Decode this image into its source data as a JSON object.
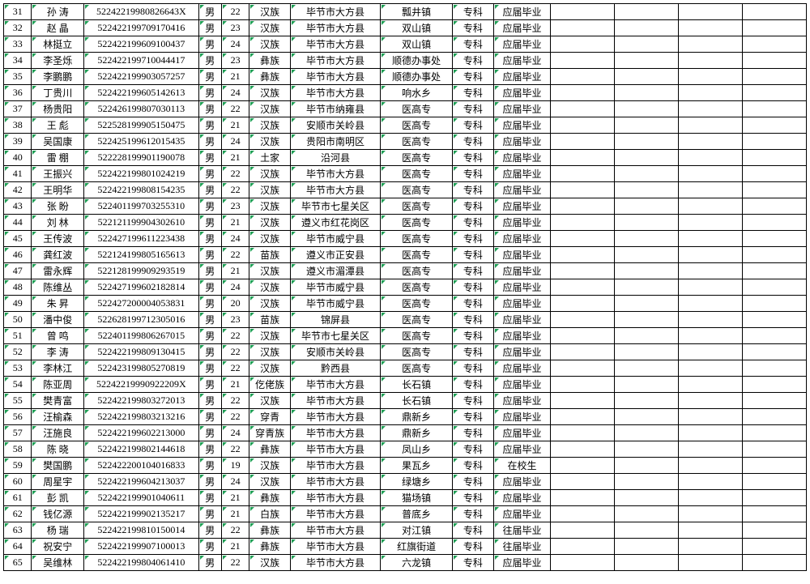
{
  "rows": [
    {
      "n": "31",
      "name": "孙  涛",
      "id": "52242219980826643X",
      "sex": "男",
      "age": "22",
      "eth": "汉族",
      "place": "毕节市大方县",
      "town": "瓢井镇",
      "edu": "专科",
      "stat": "应届毕业"
    },
    {
      "n": "32",
      "name": "赵  晶",
      "id": "522422199709170416",
      "sex": "男",
      "age": "23",
      "eth": "汉族",
      "place": "毕节市大方县",
      "town": "双山镇",
      "edu": "专科",
      "stat": "应届毕业"
    },
    {
      "n": "33",
      "name": "林挺立",
      "id": "522422199609100437",
      "sex": "男",
      "age": "24",
      "eth": "汉族",
      "place": "毕节市大方县",
      "town": "双山镇",
      "edu": "专科",
      "stat": "应届毕业"
    },
    {
      "n": "34",
      "name": "李圣烁",
      "id": "522422199710044417",
      "sex": "男",
      "age": "23",
      "eth": "彝族",
      "place": "毕节市大方县",
      "town": "顺德办事处",
      "edu": "专科",
      "stat": "应届毕业"
    },
    {
      "n": "35",
      "name": "李鹏鹏",
      "id": "522422199903057257",
      "sex": "男",
      "age": "21",
      "eth": "彝族",
      "place": "毕节市大方县",
      "town": "顺德办事处",
      "edu": "专科",
      "stat": "应届毕业"
    },
    {
      "n": "36",
      "name": "丁贵川",
      "id": "522422199605142613",
      "sex": "男",
      "age": "24",
      "eth": "汉族",
      "place": "毕节市大方县",
      "town": "响水乡",
      "edu": "专科",
      "stat": "应届毕业"
    },
    {
      "n": "37",
      "name": "杨贵阳",
      "id": "522426199807030113",
      "sex": "男",
      "age": "22",
      "eth": "汉族",
      "place": "毕节市纳雍县",
      "town": "医高专",
      "edu": "专科",
      "stat": "应届毕业"
    },
    {
      "n": "38",
      "name": "王  彪",
      "id": "522528199905150475",
      "sex": "男",
      "age": "21",
      "eth": "汉族",
      "place": "安顺市关岭县",
      "town": "医高专",
      "edu": "专科",
      "stat": "应届毕业"
    },
    {
      "n": "39",
      "name": "吴国康",
      "id": "522425199612015435",
      "sex": "男",
      "age": "24",
      "eth": "汉族",
      "place": "贵阳市南明区",
      "town": "医高专",
      "edu": "专科",
      "stat": "应届毕业"
    },
    {
      "n": "40",
      "name": "雷  棚",
      "id": "522228199901190078",
      "sex": "男",
      "age": "21",
      "eth": "土家",
      "place": "沿河县",
      "town": "医高专",
      "edu": "专科",
      "stat": "应届毕业"
    },
    {
      "n": "41",
      "name": "王振兴",
      "id": "522422199801024219",
      "sex": "男",
      "age": "22",
      "eth": "汉族",
      "place": "毕节市大方县",
      "town": "医高专",
      "edu": "专科",
      "stat": "应届毕业"
    },
    {
      "n": "42",
      "name": "王明华",
      "id": "522422199808154235",
      "sex": "男",
      "age": "22",
      "eth": "汉族",
      "place": "毕节市大方县",
      "town": "医高专",
      "edu": "专科",
      "stat": "应届毕业"
    },
    {
      "n": "43",
      "name": "张  盼",
      "id": "522401199703255310",
      "sex": "男",
      "age": "23",
      "eth": "汉族",
      "place": "毕节市七星关区",
      "town": "医高专",
      "edu": "专科",
      "stat": "应届毕业"
    },
    {
      "n": "44",
      "name": "刘  林",
      "id": "522121199904302610",
      "sex": "男",
      "age": "21",
      "eth": "汉族",
      "place": "遵义市红花岗区",
      "town": "医高专",
      "edu": "专科",
      "stat": "应届毕业"
    },
    {
      "n": "45",
      "name": "王传波",
      "id": "522427199611223438",
      "sex": "男",
      "age": "24",
      "eth": "汉族",
      "place": "毕节市威宁县",
      "town": "医高专",
      "edu": "专科",
      "stat": "应届毕业"
    },
    {
      "n": "46",
      "name": "龚红波",
      "id": "522124199805165613",
      "sex": "男",
      "age": "22",
      "eth": "苗族",
      "place": "遵义市正安县",
      "town": "医高专",
      "edu": "专科",
      "stat": "应届毕业"
    },
    {
      "n": "47",
      "name": "雷永辉",
      "id": "522128199909293519",
      "sex": "男",
      "age": "21",
      "eth": "汉族",
      "place": "遵义市湄潭县",
      "town": "医高专",
      "edu": "专科",
      "stat": "应届毕业"
    },
    {
      "n": "48",
      "name": "陈维丛",
      "id": "522427199602182814",
      "sex": "男",
      "age": "24",
      "eth": "汉族",
      "place": "毕节市威宁县",
      "town": "医高专",
      "edu": "专科",
      "stat": "应届毕业"
    },
    {
      "n": "49",
      "name": "朱  昇",
      "id": "522427200004053831",
      "sex": "男",
      "age": "20",
      "eth": "汉族",
      "place": "毕节市威宁县",
      "town": "医高专",
      "edu": "专科",
      "stat": "应届毕业"
    },
    {
      "n": "50",
      "name": "潘中俊",
      "id": "522628199712305016",
      "sex": "男",
      "age": "23",
      "eth": "苗族",
      "place": "锦屏县",
      "town": "医高专",
      "edu": "专科",
      "stat": "应届毕业"
    },
    {
      "n": "51",
      "name": "曾  鸣",
      "id": "522401199806267015",
      "sex": "男",
      "age": "22",
      "eth": "汉族",
      "place": "毕节市七星关区",
      "town": "医高专",
      "edu": "专科",
      "stat": "应届毕业"
    },
    {
      "n": "52",
      "name": "李  涛",
      "id": "522422199809130415",
      "sex": "男",
      "age": "22",
      "eth": "汉族",
      "place": "安顺市关岭县",
      "town": "医高专",
      "edu": "专科",
      "stat": "应届毕业"
    },
    {
      "n": "53",
      "name": "李林江",
      "id": "522423199805270819",
      "sex": "男",
      "age": "22",
      "eth": "汉族",
      "place": "黔西县",
      "town": "医高专",
      "edu": "专科",
      "stat": "应届毕业"
    },
    {
      "n": "54",
      "name": "陈亚周",
      "id": "52242219990922209X",
      "sex": "男",
      "age": "21",
      "eth": "仡佬族",
      "place": "毕节市大方县",
      "town": "长石镇",
      "edu": "专科",
      "stat": "应届毕业"
    },
    {
      "n": "55",
      "name": "樊青富",
      "id": "522422199803272013",
      "sex": "男",
      "age": "22",
      "eth": "汉族",
      "place": "毕节市大方县",
      "town": "长石镇",
      "edu": "专科",
      "stat": "应届毕业"
    },
    {
      "n": "56",
      "name": "汪榆森",
      "id": "522422199803213216",
      "sex": "男",
      "age": "22",
      "eth": "穿青",
      "place": "毕节市大方县",
      "town": "鼎新乡",
      "edu": "专科",
      "stat": "应届毕业"
    },
    {
      "n": "57",
      "name": "汪施良",
      "id": "522422199602213000",
      "sex": "男",
      "age": "24",
      "eth": "穿青族",
      "place": "毕节市大方县",
      "town": "鼎新乡",
      "edu": "专科",
      "stat": "应届毕业"
    },
    {
      "n": "58",
      "name": "陈  晓",
      "id": "522422199802144618",
      "sex": "男",
      "age": "22",
      "eth": "彝族",
      "place": "毕节市大方县",
      "town": "凤山乡",
      "edu": "专科",
      "stat": "应届毕业"
    },
    {
      "n": "59",
      "name": "樊国鹏",
      "id": "522422200104016833",
      "sex": "男",
      "age": "19",
      "eth": "汉族",
      "place": "毕节市大方县",
      "town": "果瓦乡",
      "edu": "专科",
      "stat": "在校生"
    },
    {
      "n": "60",
      "name": "周星宇",
      "id": "522422199604213037",
      "sex": "男",
      "age": "24",
      "eth": "汉族",
      "place": "毕节市大方县",
      "town": "绿塘乡",
      "edu": "专科",
      "stat": "应届毕业"
    },
    {
      "n": "61",
      "name": "彭  凯",
      "id": "522422199901040611",
      "sex": "男",
      "age": "21",
      "eth": "彝族",
      "place": "毕节市大方县",
      "town": "猫场镇",
      "edu": "专科",
      "stat": "应届毕业"
    },
    {
      "n": "62",
      "name": "钱亿源",
      "id": "522422199902135217",
      "sex": "男",
      "age": "21",
      "eth": "白族",
      "place": "毕节市大方县",
      "town": "普底乡",
      "edu": "专科",
      "stat": "应届毕业"
    },
    {
      "n": "63",
      "name": "杨  瑞",
      "id": "522422199810150014",
      "sex": "男",
      "age": "22",
      "eth": "彝族",
      "place": "毕节市大方县",
      "town": "对江镇",
      "edu": "专科",
      "stat": "往届毕业"
    },
    {
      "n": "64",
      "name": "祝安宁",
      "id": "522422199907100013",
      "sex": "男",
      "age": "21",
      "eth": "彝族",
      "place": "毕节市大方县",
      "town": "红旗街道",
      "edu": "专科",
      "stat": "往届毕业"
    },
    {
      "n": "65",
      "name": "吴维林",
      "id": "522422199804061410",
      "sex": "男",
      "age": "22",
      "eth": "汉族",
      "place": "毕节市大方县",
      "town": "六龙镇",
      "edu": "专科",
      "stat": "应届毕业"
    }
  ]
}
